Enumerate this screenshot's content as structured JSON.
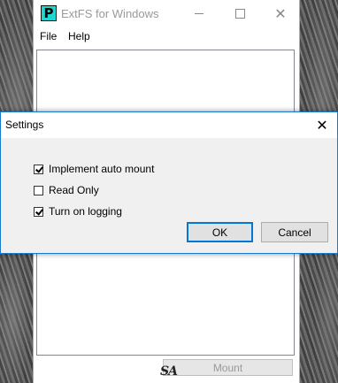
{
  "main_window": {
    "title": "ExtFS for Windows",
    "icon_letter": "P",
    "menu": [
      "File",
      "Help"
    ],
    "mount_label": "Mount",
    "watermark": "SA"
  },
  "dialog": {
    "title": "Settings",
    "options": [
      {
        "label": "Implement auto mount",
        "checked": true
      },
      {
        "label": "Read Only",
        "checked": false
      },
      {
        "label": "Turn on logging",
        "checked": true
      }
    ],
    "ok_label": "OK",
    "cancel_label": "Cancel"
  },
  "icons": {
    "app": "extfs-app-icon",
    "minimize": "minimize-icon",
    "maximize": "maximize-icon",
    "close": "close-icon",
    "check": "checkmark-icon"
  },
  "colors": {
    "app_icon_bg": "#20d6d0",
    "dialog_border": "#1979ca",
    "default_button_border": "#0078d7"
  }
}
